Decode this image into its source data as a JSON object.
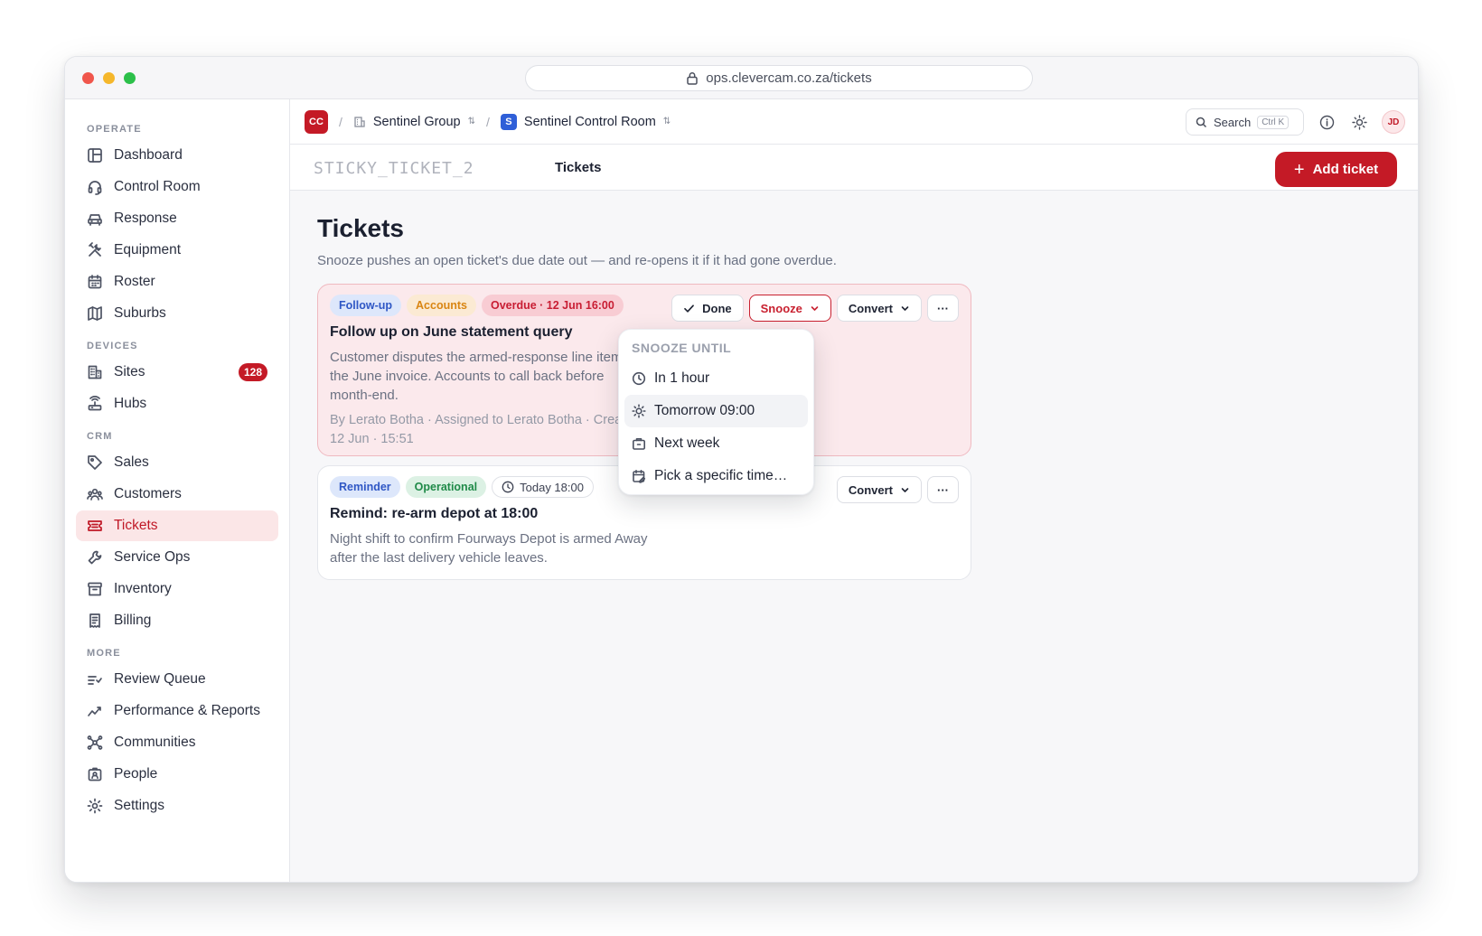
{
  "browser": {
    "url": "ops.clevercam.co.za/tickets"
  },
  "sidebar": {
    "sections": [
      {
        "label": "OPERATE"
      },
      {
        "label": "DEVICES"
      },
      {
        "label": "CRM"
      },
      {
        "label": "MORE"
      }
    ],
    "items": [
      {
        "label": "Dashboard"
      },
      {
        "label": "Control Room"
      },
      {
        "label": "Response"
      },
      {
        "label": "Equipment"
      },
      {
        "label": "Roster"
      },
      {
        "label": "Suburbs"
      },
      {
        "label": "Sites",
        "badge": "128"
      },
      {
        "label": "Hubs"
      },
      {
        "label": "Sales"
      },
      {
        "label": "Customers"
      },
      {
        "label": "Tickets"
      },
      {
        "label": "Service Ops"
      },
      {
        "label": "Inventory"
      },
      {
        "label": "Billing"
      },
      {
        "label": "Review Queue"
      },
      {
        "label": "Performance & Reports"
      },
      {
        "label": "Communities"
      },
      {
        "label": "People"
      },
      {
        "label": "Settings"
      }
    ]
  },
  "topbar": {
    "org_initials": "CC",
    "group": "Sentinel Group",
    "room_initial": "S",
    "room": "Sentinel Control Room",
    "search_label": "Search",
    "search_shortcut": "Ctrl K",
    "avatar_initials": "JD"
  },
  "pagebar": {
    "sticky_label": "STICKY_TICKET_2",
    "page_label": "Tickets",
    "add_label": "Add ticket"
  },
  "main": {
    "title": "Tickets",
    "subtitle": "Snooze pushes an open ticket's due date out — and re-opens it if it had gone overdue."
  },
  "tickets": [
    {
      "tags": [
        "Follow-up",
        "Accounts",
        "Overdue · 12 Jun 16:00"
      ],
      "title": "Follow up on June statement query",
      "body": "Customer disputes the armed-response line item on the June invoice. Accounts to call back before month-end.",
      "meta": "By Lerato Botha · Assigned to Lerato Botha · Created 12 Jun · 15:51",
      "actions": {
        "done": "Done",
        "snooze": "Snooze",
        "convert": "Convert",
        "more": "···"
      }
    },
    {
      "tags": [
        "Reminder",
        "Operational",
        "Today 18:00"
      ],
      "title": "Remind: re-arm depot at 18:00",
      "body": "Night shift to confirm Fourways Depot is armed Away after the last delivery vehicle leaves.",
      "actions": {
        "convert": "Convert",
        "more": "···"
      }
    }
  ],
  "snooze_menu": {
    "title": "SNOOZE UNTIL",
    "options": [
      "In 1 hour",
      "Tomorrow 09:00",
      "Next week",
      "Pick a specific time…"
    ]
  },
  "colors": {
    "brand": "#c41a26",
    "overdue_bg": "#fbe9ec"
  }
}
